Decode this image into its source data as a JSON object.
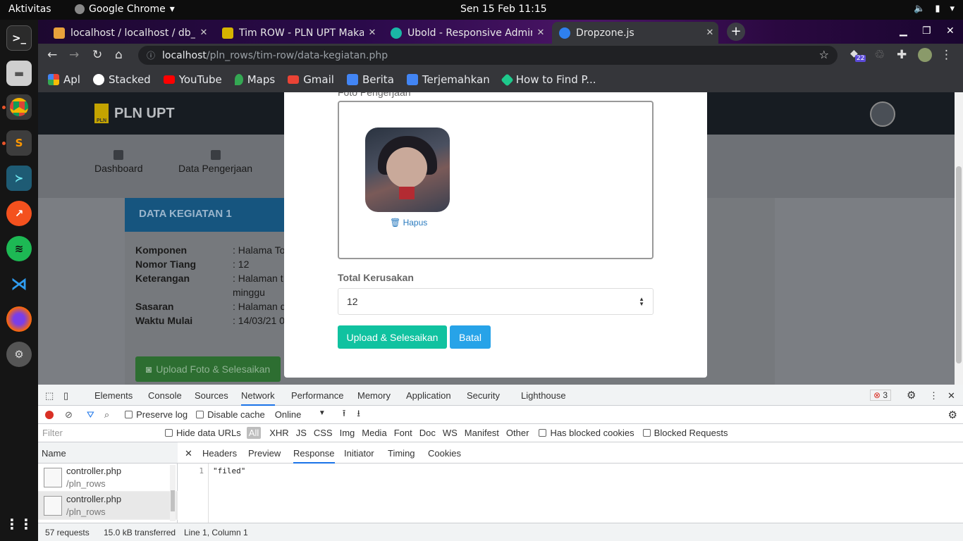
{
  "topbar": {
    "activities": "Aktivitas",
    "app": "Google Chrome",
    "clock": "Sen 15 Feb  11:15"
  },
  "tabs": [
    {
      "title": "localhost / localhost / db_",
      "active": false,
      "favicon_color": "#e8a13b"
    },
    {
      "title": "Tim ROW - PLN UPT Makas",
      "active": false,
      "favicon_color": "#d6b400"
    },
    {
      "title": "Ubold - Responsive Admin",
      "active": false,
      "favicon_color": "#1ab7a6"
    },
    {
      "title": "Dropzone.js",
      "active": true,
      "favicon_color": "#2f80ed"
    }
  ],
  "address": {
    "host": "localhost",
    "path": "/pln_rows/tim-row/data-kegiatan.php"
  },
  "extension_badge": "22",
  "bookmarks": [
    {
      "label": "Apl",
      "color": "#4285f4"
    },
    {
      "label": "Stacked",
      "color": "#ffffff"
    },
    {
      "label": "YouTube",
      "color": "#ff0000"
    },
    {
      "label": "Maps",
      "color": "#34a853"
    },
    {
      "label": "Gmail",
      "color": "#ea4335"
    },
    {
      "label": "Berita",
      "color": "#4285f4"
    },
    {
      "label": "Terjemahkan",
      "color": "#4285f4"
    },
    {
      "label": "How to Find P...",
      "color": "#1ec98c"
    }
  ],
  "site": {
    "brand": "PLN UPT",
    "menu": [
      {
        "label": "Dashboard"
      },
      {
        "label": "Data Pengerjaan"
      }
    ],
    "card_title": "DATA KEGIATAN 1",
    "rows": [
      {
        "label": "Komponen",
        "value": ": Halama To"
      },
      {
        "label": "Nomor Tiang",
        "value": ": 12"
      },
      {
        "label": "Keterangan",
        "value": ": Halaman t"
      },
      {
        "label": "",
        "value": "minggu"
      },
      {
        "label": "Sasaran",
        "value": ": Halaman d"
      },
      {
        "label": "Waktu Mulai",
        "value": ": 14/03/21 0"
      }
    ],
    "upload_button": "Upload Foto & Selesaikan"
  },
  "modal": {
    "photo_label": "Foto Pengerjaan",
    "remove_link": "Hapus",
    "total_label": "Total Kerusakan",
    "total_value": "12",
    "submit_button": "Upload & Selesaikan",
    "cancel_button": "Batal"
  },
  "devtools": {
    "tabs": [
      "Elements",
      "Console",
      "Sources",
      "Network",
      "Performance",
      "Memory",
      "Application",
      "Security",
      "Lighthouse"
    ],
    "active_tab": "Network",
    "error_count": "3",
    "preserve_log": "Preserve log",
    "disable_cache": "Disable cache",
    "throttle": "Online",
    "filter_placeholder": "Filter",
    "hide_data_urls": "Hide data URLs",
    "types": [
      "All",
      "XHR",
      "JS",
      "CSS",
      "Img",
      "Media",
      "Font",
      "Doc",
      "WS",
      "Manifest",
      "Other"
    ],
    "blocked_cookies": "Has blocked cookies",
    "blocked_requests": "Blocked Requests",
    "name_header": "Name",
    "requests": [
      {
        "name": "controller.php",
        "path": "/pln_rows"
      },
      {
        "name": "controller.php",
        "path": "/pln_rows"
      }
    ],
    "detail_tabs": [
      "Headers",
      "Preview",
      "Response",
      "Initiator",
      "Timing",
      "Cookies"
    ],
    "active_detail_tab": "Response",
    "response_line_number": "1",
    "response_body": "\"filed\"",
    "status_requests": "57 requests",
    "status_transferred": "15.0 kB transferred",
    "status_cursor": "Line 1, Column 1"
  }
}
